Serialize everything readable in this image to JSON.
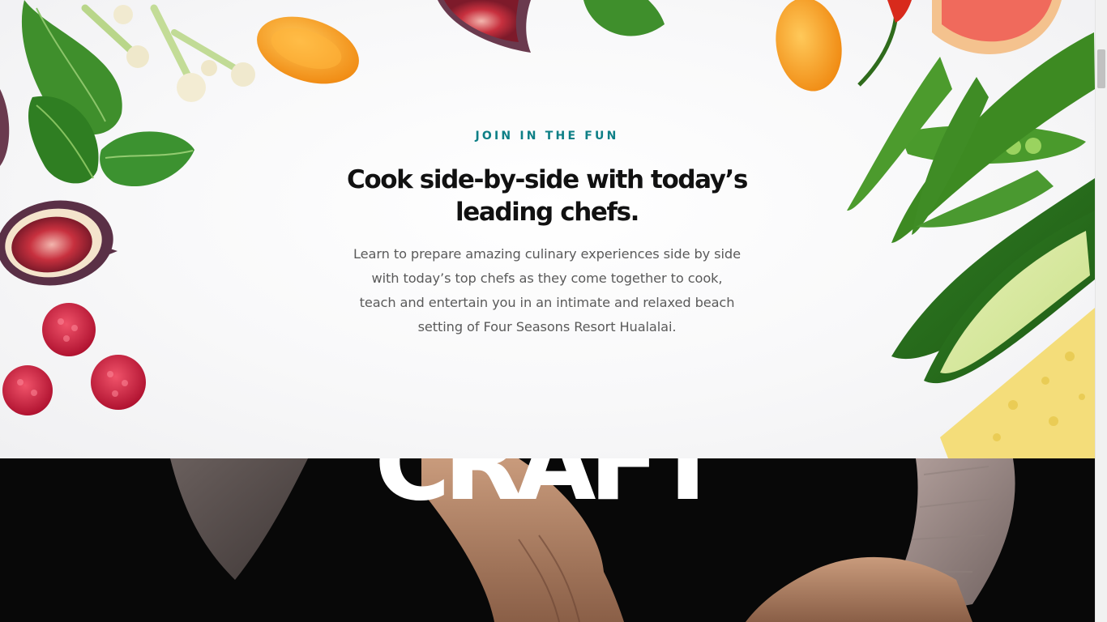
{
  "intro": {
    "eyebrow": "JOIN IN THE FUN",
    "headline": "Cook side-by-side with today’s leading chefs.",
    "body": "Learn to prepare amazing culinary experiences side by side with today’s top chefs as they come together to cook, teach and entertain you in an intimate and relaxed beach setting of Four Seasons Resort Hualalai."
  },
  "craft_section": {
    "heading": "CRAFT"
  },
  "decoration": {
    "left_items": [
      "spinach-leaf",
      "cauliflower",
      "fig",
      "raspberry",
      "orange-pepper"
    ],
    "right_items": [
      "pea-pod",
      "cucumber",
      "cheese",
      "grapefruit",
      "chili-pepper",
      "yellow-pepper"
    ]
  },
  "colors": {
    "eyebrow": "#0d7f86",
    "headline": "#111111",
    "body": "#5a5a5a",
    "craft_bg": "#080808"
  },
  "scrollbar": {
    "position": "top"
  }
}
